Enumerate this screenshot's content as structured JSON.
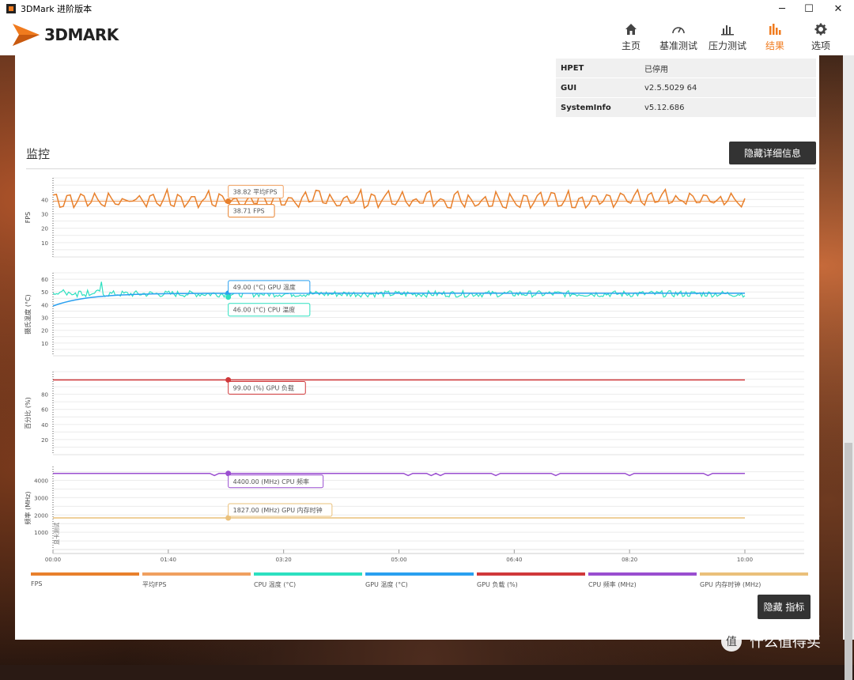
{
  "window": {
    "title": "3DMark 进阶版本",
    "minimize": "─",
    "maximize": "☐",
    "close": "✕"
  },
  "brand": {
    "name": "3DMARK"
  },
  "nav": [
    {
      "label": "主页",
      "icon": "home-icon"
    },
    {
      "label": "基准测试",
      "icon": "gauge-icon"
    },
    {
      "label": "压力测试",
      "icon": "stress-bars-icon"
    },
    {
      "label": "结果",
      "icon": "results-bars-icon",
      "active": true
    },
    {
      "label": "选项",
      "icon": "gear-icon"
    }
  ],
  "info_rows": [
    {
      "key": "HPET",
      "value": "已停用"
    },
    {
      "key": "GUI",
      "value": "v2.5.5029 64"
    },
    {
      "key": "SystemInfo",
      "value": "v5.12.686"
    }
  ],
  "monitor": {
    "title": "监控",
    "hide_details_label": "隐藏详细信息",
    "hide_metrics_label": "隐藏 指标"
  },
  "colors": {
    "fps": "#e8802c",
    "avg_fps": "#f0a060",
    "cpu_temp": "#2de0c0",
    "gpu_temp": "#2aa0f0",
    "gpu_load": "#d0383a",
    "cpu_freq": "#9a4ed0",
    "gpu_mem_clock": "#eac07a"
  },
  "chart_data": {
    "type": "line",
    "x_ticks": [
      "00:00",
      "01:40",
      "03:20",
      "05:00",
      "06:40",
      "08:20",
      "10:00"
    ],
    "xlim_seconds": [
      0,
      600
    ],
    "panels": [
      {
        "ylabel": "FPS",
        "yticks": [
          10,
          20,
          30,
          40
        ],
        "ylim": [
          0,
          55
        ],
        "series": [
          {
            "name": "FPS",
            "mean": 39,
            "min": 34,
            "max": 47,
            "readout": "38.71 FPS"
          },
          {
            "name": "平均FPS",
            "value": 38.82,
            "readout": "38.82 平均FPS"
          }
        ]
      },
      {
        "ylabel": "摄氏温度 (°C)",
        "yticks": [
          10,
          20,
          30,
          40,
          50,
          60
        ],
        "ylim": [
          0,
          65
        ],
        "series": [
          {
            "name": "GPU 温度",
            "start": 39,
            "end": 49,
            "readout": "49.00 (°C) GPU 温度"
          },
          {
            "name": "CPU 温度",
            "mean": 49,
            "min": 45,
            "max": 58,
            "readout": "46.00 (°C) CPU 温度"
          }
        ]
      },
      {
        "ylabel": "百分比 (%)",
        "yticks": [
          20,
          40,
          60,
          80
        ],
        "ylim": [
          0,
          110
        ],
        "series": [
          {
            "name": "GPU 负载",
            "value": 99,
            "readout": "99.00 (%) GPU 负载"
          }
        ]
      },
      {
        "ylabel": "频率 (MHz)",
        "yticks": [
          1000,
          2000,
          3000,
          4000
        ],
        "ylim": [
          0,
          4800
        ],
        "marker_label": "显卡测试",
        "series": [
          {
            "name": "CPU 频率",
            "value": 4400,
            "readout": "4400.00 (MHz) CPU 频率"
          },
          {
            "name": "GPU 内存时钟",
            "value": 1827,
            "readout": "1827.00 (MHz) GPU 内存时钟"
          }
        ]
      }
    ],
    "cursor_time_seconds": 152
  },
  "legend": [
    {
      "label": "FPS",
      "color_key": "fps"
    },
    {
      "label": "平均FPS",
      "color_key": "avg_fps"
    },
    {
      "label": "CPU 温度 (°C)",
      "color_key": "cpu_temp"
    },
    {
      "label": "GPU 温度 (°C)",
      "color_key": "gpu_temp"
    },
    {
      "label": "GPU 负载 (%)",
      "color_key": "gpu_load"
    },
    {
      "label": "CPU 频率 (MHz)",
      "color_key": "cpu_freq"
    },
    {
      "label": "GPU 内存时钟 (MHz)",
      "color_key": "gpu_mem_clock"
    }
  ],
  "watermark": {
    "icon_text": "值",
    "text": "什么值得买"
  }
}
